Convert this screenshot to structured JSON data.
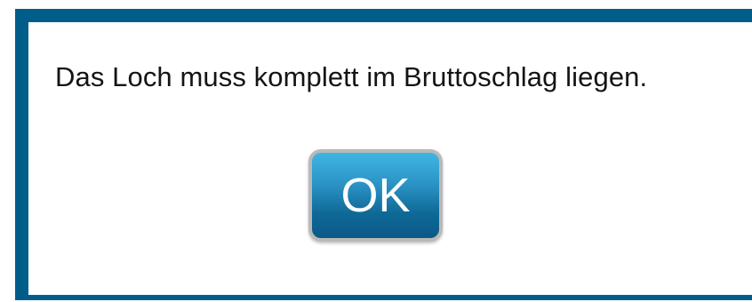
{
  "dialog": {
    "message": "Das Loch muss komplett im Bruttoschlag liegen.",
    "ok_label": "OK"
  },
  "colors": {
    "frame": "#005d8a",
    "button_top": "#3fb6e4",
    "button_bottom": "#0a5a86",
    "button_border": "#b9b9b9"
  }
}
